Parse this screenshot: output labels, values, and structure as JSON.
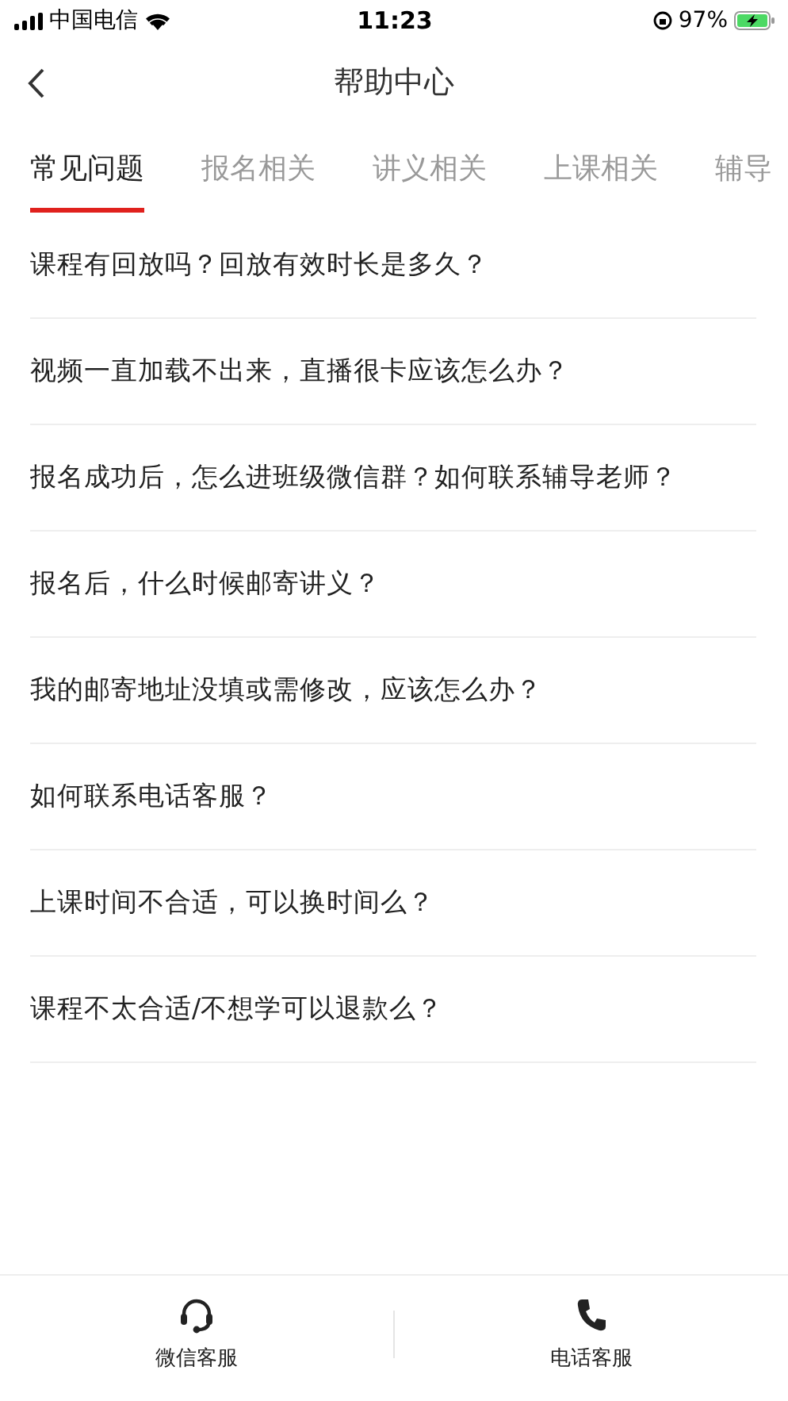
{
  "status_bar": {
    "carrier": "中国电信",
    "time": "11:23",
    "battery": "97%"
  },
  "nav": {
    "title": "帮助中心"
  },
  "tabs": [
    {
      "label": "常见问题",
      "selected": true
    },
    {
      "label": "报名相关",
      "selected": false
    },
    {
      "label": "讲义相关",
      "selected": false
    },
    {
      "label": "上课相关",
      "selected": false
    },
    {
      "label": "辅导",
      "selected": false
    }
  ],
  "questions": [
    "课程有回放吗？回放有效时长是多久？",
    "视频一直加载不出来，直播很卡应该怎么办？",
    "报名成功后，怎么进班级微信群？如何联系辅导老师？",
    "报名后，什么时候邮寄讲义？",
    "我的邮寄地址没填或需修改，应该怎么办？",
    "如何联系电话客服？",
    "上课时间不合适，可以换时间么？",
    "课程不太合适/不想学可以退款么？"
  ],
  "bottom_bar": [
    {
      "kind": "headset",
      "label": "微信客服"
    },
    {
      "kind": "phone",
      "label": "电话客服"
    }
  ]
}
